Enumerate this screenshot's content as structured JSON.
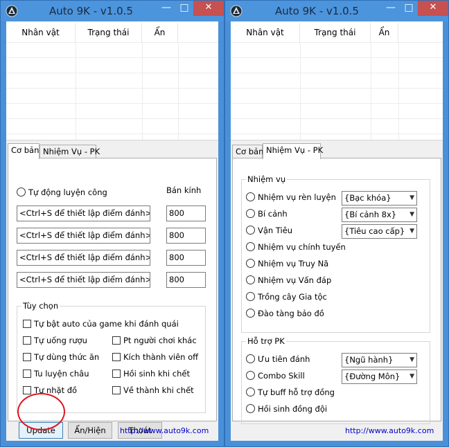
{
  "colors": {
    "titlebar": "#4c94dc",
    "close_button": "#c75050",
    "link": "#0000cc",
    "annotation": "#e0141e"
  },
  "left_window": {
    "title": "Auto 9K - v1.0.5",
    "controls": {
      "minimize": "—",
      "maximize": "□",
      "close": "✕"
    },
    "list_columns": [
      "Nhân vật",
      "Trạng thái",
      "Ẩn"
    ],
    "tabs": [
      "Cơ bản",
      "Nhiệm Vụ - PK"
    ],
    "auto_train_label": "Tự động luyện công",
    "radius_label": "Bán kính",
    "points": [
      {
        "text": "<Ctrl+S để thiết lập điểm đánh>",
        "radius": "800"
      },
      {
        "text": "<Ctrl+S để thiết lập điểm đánh>",
        "radius": "800"
      },
      {
        "text": "<Ctrl+S để thiết lập điểm đánh>",
        "radius": "800"
      },
      {
        "text": "<Ctrl+S để thiết lập điểm đánh>",
        "radius": "800"
      }
    ],
    "options_group": "Tùy chọn",
    "options": {
      "game_auto": "Tự bật auto của game khi đánh quái",
      "drink_wine": "Tự uống rượu",
      "pt_others": "Pt người chơi khác",
      "eat_food": "Tự dùng thức ăn",
      "kick_off": "Kích thành viên off",
      "train_pearl": "Tu luyện châu",
      "revive_death": "Hồi sinh khi chết",
      "pick_items": "Tự nhặt đồ",
      "return_city": "Về thành khi chết"
    },
    "buttons": {
      "update": "Update",
      "show_hide": "Ẩn/Hiện",
      "exit": "Thoát"
    },
    "link": "http://www.auto9k.com"
  },
  "right_window": {
    "title": "Auto 9K - v1.0.5",
    "controls": {
      "minimize": "—",
      "maximize": "□",
      "close": "✕"
    },
    "list_columns": [
      "Nhân vật",
      "Trạng thái",
      "Ẩn"
    ],
    "tabs": [
      "Cơ bản",
      "Nhiệm Vụ - PK"
    ],
    "quest_group": "Nhiệm vụ",
    "quests": [
      {
        "label": "Nhiệm vụ rèn luyện",
        "select": "{Bạc khóa}"
      },
      {
        "label": "Bí cảnh",
        "select": "{Bí cảnh 8x}"
      },
      {
        "label": "Vận Tiêu",
        "select": "{Tiêu cao cấp}"
      },
      {
        "label": "Nhiệm vụ chính tuyến"
      },
      {
        "label": "Nhiệm vụ Truy Nã"
      },
      {
        "label": "Nhiệm vụ Vấn đáp"
      },
      {
        "label": "Trồng cây Gia tộc"
      },
      {
        "label": "Đào tàng bảo đồ"
      }
    ],
    "pk_group": "Hỗ trợ PK",
    "pk": [
      {
        "label": "Ưu tiên đánh",
        "select": "{Ngũ hành}"
      },
      {
        "label": "Combo Skill",
        "select": "{Đường Môn}"
      },
      {
        "label": "Tự buff hỗ trợ đồng"
      },
      {
        "label": "Hồi sinh đồng đội"
      }
    ],
    "link": "http://www.auto9k.com"
  }
}
